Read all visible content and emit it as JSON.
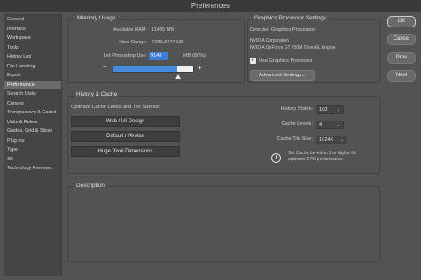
{
  "window": {
    "title": "Preferences"
  },
  "sidebar": {
    "items": [
      {
        "label": "General"
      },
      {
        "label": "Interface"
      },
      {
        "label": "Workspace"
      },
      {
        "label": "Tools"
      },
      {
        "label": "History Log"
      },
      {
        "label": "File Handling"
      },
      {
        "label": "Export"
      },
      {
        "label": "Performance",
        "selected": true
      },
      {
        "label": "Scratch Disks"
      },
      {
        "label": "Cursors"
      },
      {
        "label": "Transparency & Gamut"
      },
      {
        "label": "Units & Rulers"
      },
      {
        "label": "Guides, Grid & Slices"
      },
      {
        "label": "Plug-ins"
      },
      {
        "label": "Type"
      },
      {
        "label": "3D"
      },
      {
        "label": "Technology Previews"
      }
    ]
  },
  "memory": {
    "title": "Memory Usage",
    "available_label": "Available RAM:",
    "available_value": "11435 MB",
    "ideal_label": "Ideal Range:",
    "ideal_value": "6289-8233 MB",
    "let_use_label": "Let Photoshop Use:",
    "let_use_value": "9148",
    "let_use_unit": "MB (80%)",
    "minus": "−",
    "plus": "+",
    "slider_fraction": 0.8
  },
  "gpu": {
    "title": "Graphics Processor Settings",
    "detected_label": "Detected Graphics Processor:",
    "vendor": "NVIDIA Corporation",
    "model": "NVIDIA GeForce GT 750M OpenGL Engine",
    "use_gpu_label": "Use Graphics Processor",
    "use_gpu_checked": true,
    "advanced_button": "Advanced Settings..."
  },
  "history_cache": {
    "title": "History & Cache",
    "optimize_label": "Optimize Cache Levels and Tile Size for:",
    "buttons": [
      "Web / UI Design",
      "Default / Photos",
      "Huge Pixel Dimensions"
    ],
    "history_states_label": "History States:",
    "history_states_value": "100",
    "cache_levels_label": "Cache Levels:",
    "cache_levels_value": "4",
    "tile_size_label": "Cache Tile Size:",
    "tile_size_value": "1024K",
    "info_text_1": "Set Cache Levels to 2 or higher for",
    "info_text_2": "optimum GPU performance."
  },
  "description": {
    "title": "Description"
  },
  "actions": {
    "ok": "OK",
    "cancel": "Cancel",
    "prev": "Prev",
    "next": "Next"
  }
}
